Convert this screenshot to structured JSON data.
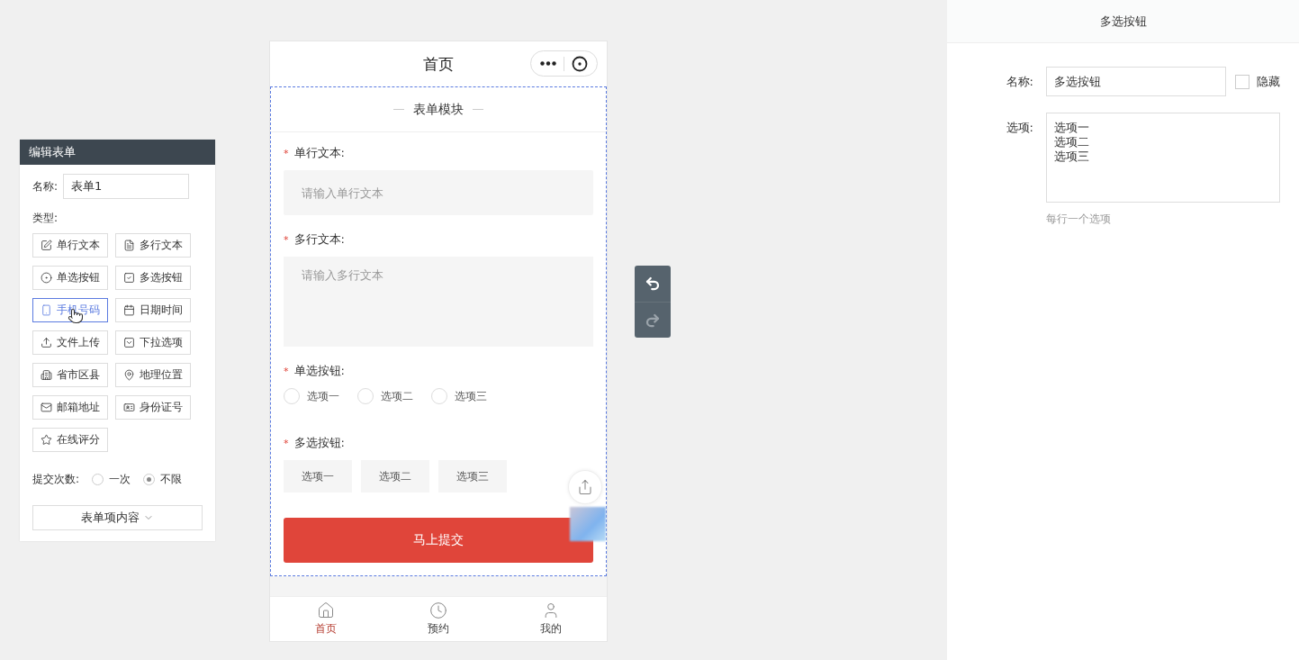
{
  "editor": {
    "title": "编辑表单",
    "name_label": "名称:",
    "name_value": "表单1",
    "type_label": "类型:",
    "types": [
      {
        "kind": "text",
        "label": "单行文本",
        "selected": false
      },
      {
        "kind": "textarea",
        "label": "多行文本",
        "selected": false
      },
      {
        "kind": "radio",
        "label": "单选按钮",
        "selected": false
      },
      {
        "kind": "checkbox",
        "label": "多选按钮",
        "selected": false
      },
      {
        "kind": "phone",
        "label": "手机号码",
        "selected": true
      },
      {
        "kind": "date",
        "label": "日期时间",
        "selected": false
      },
      {
        "kind": "upload",
        "label": "文件上传",
        "selected": false
      },
      {
        "kind": "select",
        "label": "下拉选项",
        "selected": false
      },
      {
        "kind": "region",
        "label": "省市区县",
        "selected": false
      },
      {
        "kind": "location",
        "label": "地理位置",
        "selected": false
      },
      {
        "kind": "email",
        "label": "邮箱地址",
        "selected": false
      },
      {
        "kind": "idcard",
        "label": "身份证号",
        "selected": false
      },
      {
        "kind": "rating",
        "label": "在线评分",
        "selected": false
      }
    ],
    "submit_label": "提交次数:",
    "submit_options": [
      {
        "label": "一次",
        "selected": false
      },
      {
        "label": "不限",
        "selected": true
      }
    ],
    "items_button": "表单项内容"
  },
  "phone": {
    "title": "首页",
    "section_title": "表单模块",
    "fields": [
      {
        "kind": "text",
        "label": "单行文本:",
        "required_mark": "*",
        "placeholder": "请输入单行文本"
      },
      {
        "kind": "textarea",
        "label": "多行文本:",
        "required_mark": "*",
        "placeholder": "请输入多行文本"
      },
      {
        "kind": "radio",
        "label": "单选按钮:",
        "required_mark": "*",
        "options": [
          {
            "label": "选项一",
            "selected": false
          },
          {
            "label": "选项二",
            "selected": false
          },
          {
            "label": "选项三",
            "selected": false
          }
        ]
      },
      {
        "kind": "checkbox",
        "label": "多选按钮:",
        "required_mark": "*",
        "options": [
          {
            "label": "选项一",
            "selected": false
          },
          {
            "label": "选项二",
            "selected": false
          },
          {
            "label": "选项三",
            "selected": false
          }
        ]
      }
    ],
    "submit": "马上提交",
    "tabs": [
      {
        "kind": "home",
        "label": "首页",
        "selected": true
      },
      {
        "kind": "clock",
        "label": "预约",
        "selected": false
      },
      {
        "kind": "user",
        "label": "我的",
        "selected": false
      }
    ]
  },
  "properties": {
    "title": "多选按钮",
    "name_label": "名称:",
    "name_value": "多选按钮",
    "hidden_label": "隐藏",
    "hidden": false,
    "options_label": "选项:",
    "options": [
      "选项一",
      "选项二",
      "选项三"
    ],
    "hint": "每行一个选项"
  }
}
